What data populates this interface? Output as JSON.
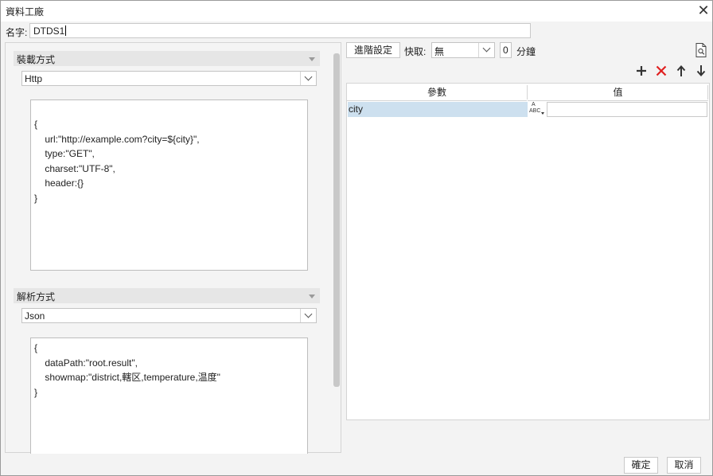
{
  "window": {
    "title": "資料工廠"
  },
  "name": {
    "label": "名字:",
    "value": "DTDS1"
  },
  "load": {
    "header": "裝載方式",
    "method": "Http",
    "script_lines": [
      "{",
      "    url:\"http://example.com?city=${city}\",",
      "    type:\"GET\",",
      "    charset:\"UTF-8\",",
      "    header:{}",
      "}"
    ]
  },
  "parse": {
    "header": "解析方式",
    "method": "Json",
    "script_lines": [
      "{",
      "    dataPath:\"root.result\",",
      "    showmap:\"district,轄区,temperature,温度\"",
      "}"
    ]
  },
  "toolbar": {
    "advanced_label": "進階設定",
    "cache_label": "快取:",
    "cache_value": "無",
    "minutes_value": "0",
    "minutes_label": "分鐘"
  },
  "params": {
    "columns": [
      "參數",
      "值"
    ],
    "rows": [
      {
        "name": "city",
        "type_icon_text": [
          "A",
          "ABC"
        ],
        "value": ""
      }
    ]
  },
  "icons": {
    "add": "plus-icon",
    "delete": "delete-x-icon",
    "up": "arrow-up-icon",
    "down": "arrow-down-icon",
    "preview": "document-search-icon",
    "close": "close-icon",
    "delete_color": "#e02020"
  },
  "footer": {
    "ok_label": "確定",
    "cancel_label": "取消"
  }
}
